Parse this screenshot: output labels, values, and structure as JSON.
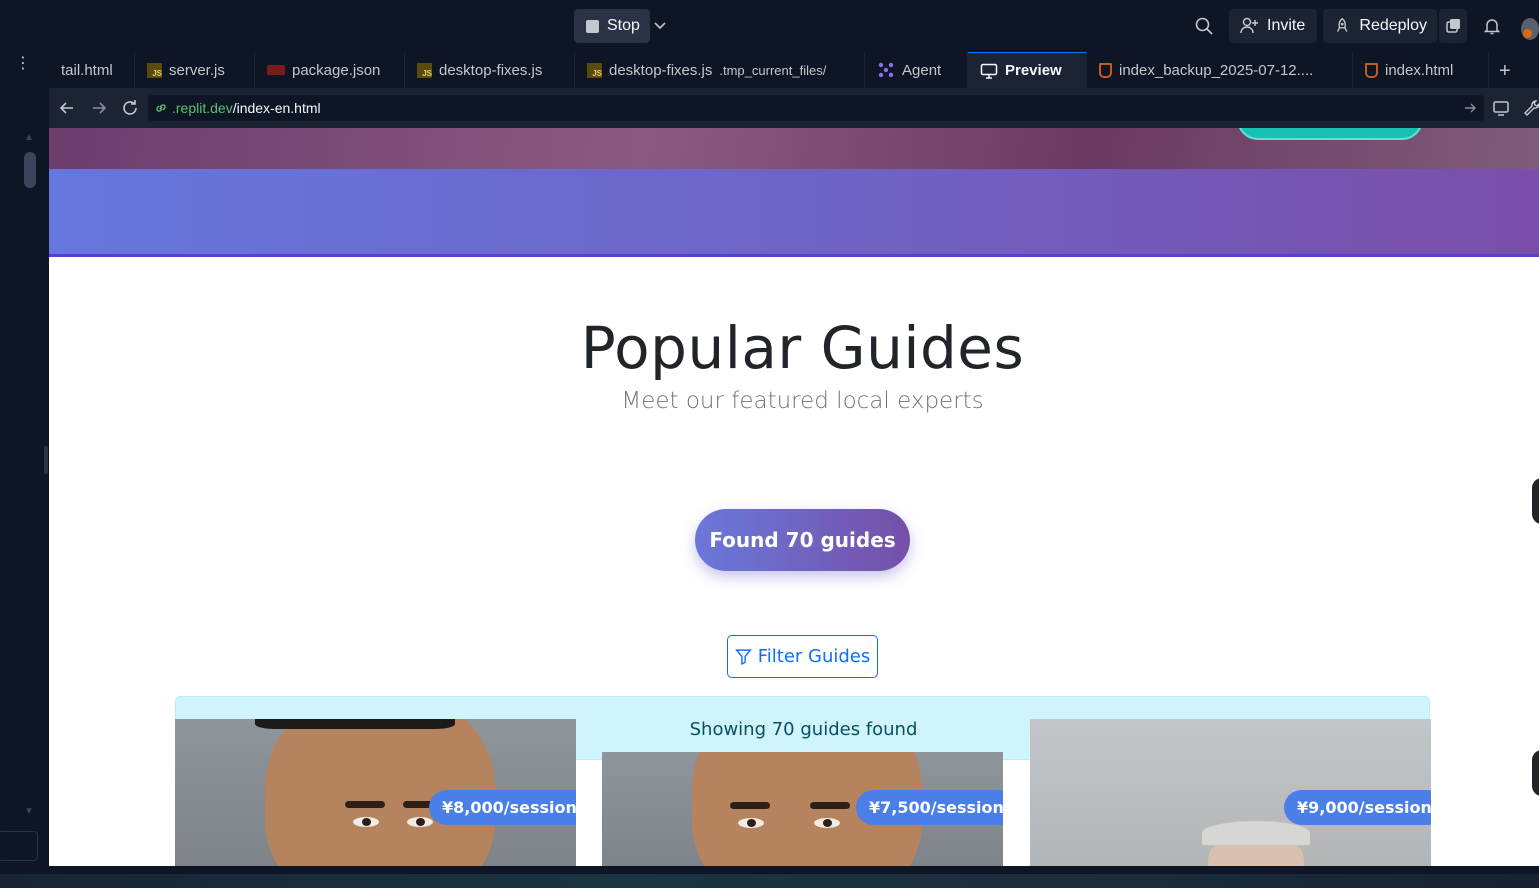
{
  "topbar": {
    "stop_label": "Stop",
    "invite_label": "Invite",
    "redeploy_label": "Redeploy"
  },
  "tabs": [
    {
      "label": "tail.html",
      "icon": "none"
    },
    {
      "label": "server.js",
      "icon": "js-file-icon"
    },
    {
      "label": "package.json",
      "icon": "package-icon"
    },
    {
      "label": "desktop-fixes.js",
      "icon": "js-file-icon"
    },
    {
      "label": "desktop-fixes.js",
      "sub": ".tmp_current_files/",
      "icon": "js-file-icon"
    },
    {
      "label": "Agent",
      "icon": "agent-icon"
    },
    {
      "label": "Preview",
      "icon": "monitor-icon",
      "active": true
    },
    {
      "label": "index_backup_2025-07-12....",
      "icon": "html-file-icon"
    },
    {
      "label": "index.html",
      "icon": "html-file-icon"
    }
  ],
  "address": {
    "domain": ".replit.dev",
    "path": "/index-en.html"
  },
  "page": {
    "title": "Popular Guides",
    "subtitle": "Meet our featured local experts",
    "found_button": "Found 70 guides",
    "filter_button": "Filter Guides",
    "info_text": "Showing 70 guides found",
    "cards": [
      {
        "price": "¥8,000/session"
      },
      {
        "price": "¥7,500/session"
      },
      {
        "price": "¥9,000/session"
      }
    ]
  },
  "colors": {
    "accent_blue": "#0d6efd",
    "gradient_start": "#6677dd",
    "gradient_end": "#7a4ea9",
    "price_badge": "#4a7fe8",
    "info_bg": "#cff4fc"
  }
}
